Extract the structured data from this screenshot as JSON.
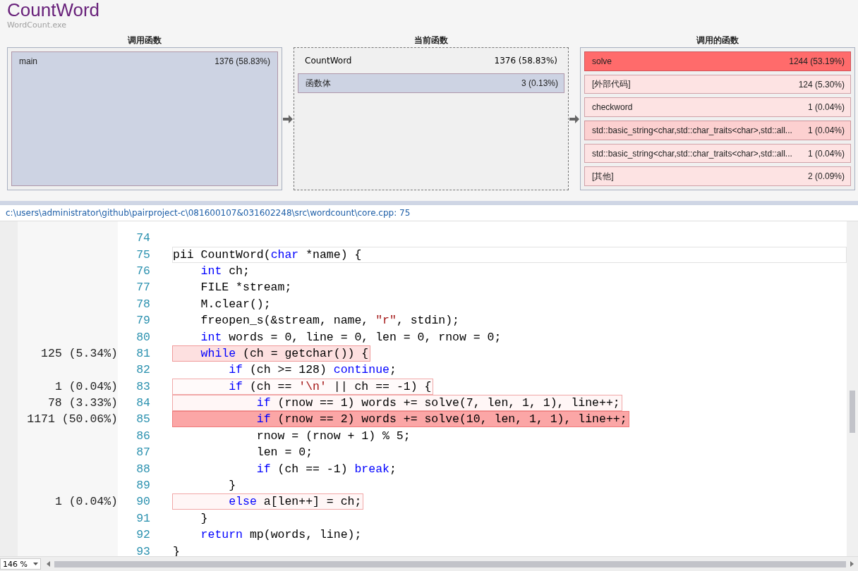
{
  "header": {
    "title": "CountWord",
    "subtitle": "WordCount.exe"
  },
  "panels": [
    {
      "kind": "callers",
      "heading": "调用函数",
      "items": [
        {
          "name": "main",
          "value": "1376 (58.83%)",
          "color": "#cdd3e3"
        }
      ]
    },
    {
      "kind": "current",
      "heading": "当前函数",
      "function": {
        "name": "CountWord",
        "value": "1376 (58.83%)"
      },
      "items": [
        {
          "name": "函数体",
          "value": "3 (0.13%)",
          "color": "#cdd3e3"
        }
      ]
    },
    {
      "kind": "callees",
      "heading": "调用的函数",
      "items": [
        {
          "name": "solve",
          "value": "1244 (53.19%)",
          "color": "#ff6b6b"
        },
        {
          "name": "[外部代码]",
          "value": "124 (5.30%)",
          "color": "#fde3e3"
        },
        {
          "name": "checkword",
          "value": "1 (0.04%)",
          "color": "#fde3e3"
        },
        {
          "name": "std::basic_string<char,std::char_traits<char>,std::all...",
          "value": "1 (0.04%)",
          "color": "#fcd0d0"
        },
        {
          "name": "std::basic_string<char,std::char_traits<char>,std::all...",
          "value": "1 (0.04%)",
          "color": "#fde3e3"
        },
        {
          "name": "[其他]",
          "value": "2 (0.09%)",
          "color": "#fde3e3"
        }
      ]
    }
  ],
  "file_path": "c:\\users\\administrator\\github\\pairproject-c\\081600107&031602248\\src\\wordcount\\core.cpp: 75",
  "code": [
    {
      "number": "74"
    },
    {
      "number": "75",
      "current": true,
      "segments": [
        {
          "kind": "plain",
          "text": "pii CountWord("
        },
        {
          "kind": "kw",
          "text": "char"
        },
        {
          "kind": "plain",
          "text": " *name) {"
        }
      ]
    },
    {
      "number": "76",
      "segments": [
        {
          "kind": "kw",
          "text": "    int"
        },
        {
          "kind": "plain",
          "text": " ch;"
        }
      ]
    },
    {
      "number": "77",
      "segments": [
        {
          "kind": "plain",
          "text": "    FILE *stream;"
        }
      ]
    },
    {
      "number": "78",
      "segments": [
        {
          "kind": "plain",
          "text": "    M.clear();"
        }
      ]
    },
    {
      "number": "79",
      "segments": [
        {
          "kind": "plain",
          "text": "    freopen_s(&stream, name, "
        },
        {
          "kind": "str",
          "text": "\"r\""
        },
        {
          "kind": "plain",
          "text": ", stdin);"
        }
      ]
    },
    {
      "number": "80",
      "segments": [
        {
          "kind": "kw",
          "text": "    int"
        },
        {
          "kind": "plain",
          "text": " words = 0, line = 0, len = 0, rnow = 0;"
        }
      ]
    },
    {
      "number": "81",
      "hits": "125 (5.34%)",
      "color": "#fde0e0",
      "segments": [
        {
          "kind": "kw",
          "text": "    while"
        },
        {
          "kind": "plain",
          "text": " (ch = getchar()) {"
        }
      ]
    },
    {
      "number": "82",
      "segments": [
        {
          "kind": "kw",
          "text": "        if"
        },
        {
          "kind": "plain",
          "text": " (ch >= 128) "
        },
        {
          "kind": "kw",
          "text": "continue"
        },
        {
          "kind": "plain",
          "text": ";"
        }
      ]
    },
    {
      "number": "83",
      "hits": "1 (0.04%)",
      "color": "#fffafa",
      "segments": [
        {
          "kind": "kw",
          "text": "        if"
        },
        {
          "kind": "plain",
          "text": " (ch == "
        },
        {
          "kind": "str",
          "text": "'\\n'"
        },
        {
          "kind": "plain",
          "text": " || ch == -1) {"
        }
      ]
    },
    {
      "number": "84",
      "hits": "78 (3.33%)",
      "color": "#fff6f6",
      "segments": [
        {
          "kind": "kw",
          "text": "            if"
        },
        {
          "kind": "plain",
          "text": " (rnow == 1) words += solve(7, len, 1, 1), line++;"
        }
      ]
    },
    {
      "number": "85",
      "hits": "1171 (50.06%)",
      "color": "#fba6a6",
      "segments": [
        {
          "kind": "kw",
          "text": "            if"
        },
        {
          "kind": "plain",
          "text": " (rnow == 2) words += solve(10, len, 1, 1), line++;"
        }
      ]
    },
    {
      "number": "86",
      "segments": [
        {
          "kind": "plain",
          "text": "            rnow = (rnow + 1) % 5;"
        }
      ]
    },
    {
      "number": "87",
      "segments": [
        {
          "kind": "plain",
          "text": "            len = 0;"
        }
      ]
    },
    {
      "number": "88",
      "segments": [
        {
          "kind": "kw",
          "text": "            if"
        },
        {
          "kind": "plain",
          "text": " (ch == -1) "
        },
        {
          "kind": "kw",
          "text": "break"
        },
        {
          "kind": "plain",
          "text": ";"
        }
      ]
    },
    {
      "number": "89",
      "segments": [
        {
          "kind": "plain",
          "text": "        }"
        }
      ]
    },
    {
      "number": "90",
      "hits": "1 (0.04%)",
      "color": "#fff6f6",
      "segments": [
        {
          "kind": "kw",
          "text": "        else"
        },
        {
          "kind": "plain",
          "text": " a[len++] = ch;"
        }
      ]
    },
    {
      "number": "91",
      "segments": [
        {
          "kind": "plain",
          "text": "    }"
        }
      ]
    },
    {
      "number": "92",
      "segments": [
        {
          "kind": "kw",
          "text": "    return"
        },
        {
          "kind": "plain",
          "text": " mp(words, line);"
        }
      ]
    },
    {
      "number": "93",
      "segments": [
        {
          "kind": "plain",
          "text": "}"
        }
      ]
    }
  ],
  "zoom": "146 %"
}
